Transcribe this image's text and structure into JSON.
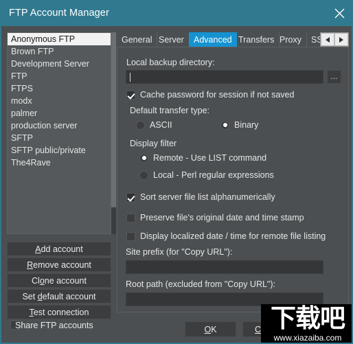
{
  "window": {
    "title": "FTP Account Manager",
    "close_icon": "close-icon",
    "accent_color": "#31798f",
    "tab_active_color": "#1593d1"
  },
  "accounts": {
    "items": [
      {
        "label": "Anonymous FTP",
        "selected": true
      },
      {
        "label": "Brown FTP",
        "selected": false
      },
      {
        "label": "Development Server",
        "selected": false
      },
      {
        "label": "FTP",
        "selected": false
      },
      {
        "label": "FTPS",
        "selected": false
      },
      {
        "label": "modx",
        "selected": false
      },
      {
        "label": "palmer",
        "selected": false
      },
      {
        "label": "production server",
        "selected": false
      },
      {
        "label": "SFTP",
        "selected": false
      },
      {
        "label": "SFTP public/private",
        "selected": false
      },
      {
        "label": "The4Rave",
        "selected": false
      }
    ]
  },
  "side_buttons": [
    {
      "prefix": "",
      "accel": "A",
      "suffix": "dd account"
    },
    {
      "prefix": "",
      "accel": "R",
      "suffix": "emove account"
    },
    {
      "prefix": "Cl",
      "accel": "o",
      "suffix": "ne account"
    },
    {
      "prefix": "Set ",
      "accel": "d",
      "suffix": "efault account"
    },
    {
      "prefix": "",
      "accel": "T",
      "suffix": "est connection"
    }
  ],
  "share": {
    "label": "Share FTP accounts",
    "checked": false
  },
  "tabs": {
    "items": [
      {
        "label": "General",
        "active": false
      },
      {
        "label": "Server",
        "active": false
      },
      {
        "label": "Advanced",
        "active": true
      },
      {
        "label": "Transfers",
        "active": false
      },
      {
        "label": "Proxy",
        "active": false
      },
      {
        "label": "SSH/SSL",
        "active": false
      }
    ],
    "scroll_left_icon": "arrow-left-icon",
    "scroll_right_icon": "arrow-right-icon"
  },
  "advanced": {
    "local_backup_label": "Local backup directory:",
    "local_backup_value": "",
    "browse_label": "...",
    "cache_password": {
      "label": "Cache password for session if not saved",
      "checked": true
    },
    "transfer_type_label": "Default transfer type:",
    "transfer_ascii": {
      "label": "ASCII",
      "checked": false
    },
    "transfer_binary": {
      "label": "Binary",
      "checked": true
    },
    "display_filter_label": "Display filter",
    "filter_remote": {
      "label": "Remote - Use LIST command",
      "checked": true
    },
    "filter_local": {
      "label": "Local - Perl regular expressions",
      "checked": false
    },
    "sort_alphanumeric": {
      "label": "Sort server file list alphanumerically",
      "checked": true
    },
    "preserve_timestamp": {
      "label": "Preserve file's original date and time stamp",
      "checked": false
    },
    "localized_date": {
      "label": "Display localized date / time for remote file listing",
      "checked": false
    },
    "site_prefix_label": "Site prefix (for \"Copy URL\"):",
    "site_prefix_value": "",
    "root_path_label": "Root path (excluded from \"Copy URL\"):",
    "root_path_value": ""
  },
  "footer": {
    "ok": {
      "prefix": "",
      "accel": "O",
      "suffix": "K"
    },
    "cancel": {
      "prefix": "",
      "accel": "C",
      "suffix": "ancel"
    }
  },
  "watermark": {
    "cjk": "下载吧",
    "url": "www.xiazaiba.com"
  }
}
